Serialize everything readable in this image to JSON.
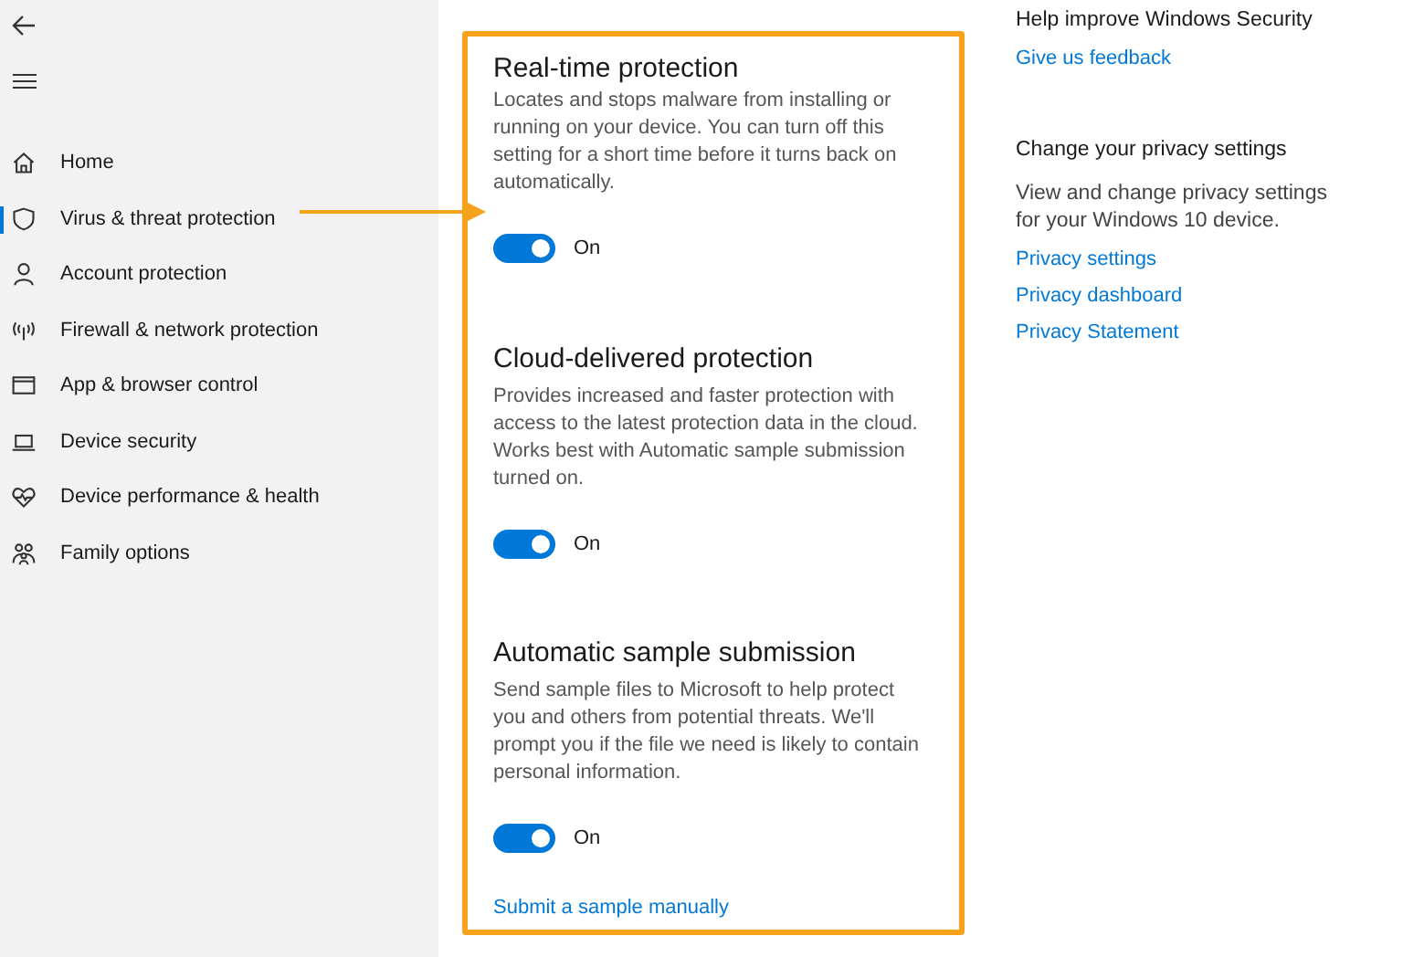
{
  "nav": {
    "items": [
      {
        "label": "Home",
        "selected": false
      },
      {
        "label": "Virus & threat protection",
        "selected": true
      },
      {
        "label": "Account protection",
        "selected": false
      },
      {
        "label": "Firewall & network protection",
        "selected": false
      },
      {
        "label": "App & browser control",
        "selected": false
      },
      {
        "label": "Device security",
        "selected": false
      },
      {
        "label": "Device performance & health",
        "selected": false
      },
      {
        "label": "Family options",
        "selected": false
      }
    ]
  },
  "settings": [
    {
      "title": "Real-time protection",
      "description": "Locates and stops malware from installing or running on your device. You can turn off this setting for a short time before it turns back on automatically.",
      "on": true,
      "state_label": "On"
    },
    {
      "title": "Cloud-delivered protection",
      "description": "Provides increased and faster protection with access to the latest protection data in the cloud. Works best with Automatic sample submission turned on.",
      "on": true,
      "state_label": "On"
    },
    {
      "title": "Automatic sample submission",
      "description": "Send sample files to Microsoft to help protect you and others from potential threats. We'll prompt you if the file we need is likely to contain personal information.",
      "on": true,
      "state_label": "On"
    }
  ],
  "submit_link": "Submit a sample manually",
  "side_panel": [
    {
      "heading": "Help improve Windows Security",
      "links": [
        "Give us feedback"
      ]
    },
    {
      "heading": "Change your privacy settings",
      "description": "View and change privacy settings for your Windows 10 device.",
      "links": [
        "Privacy settings",
        "Privacy dashboard",
        "Privacy Statement"
      ]
    }
  ]
}
